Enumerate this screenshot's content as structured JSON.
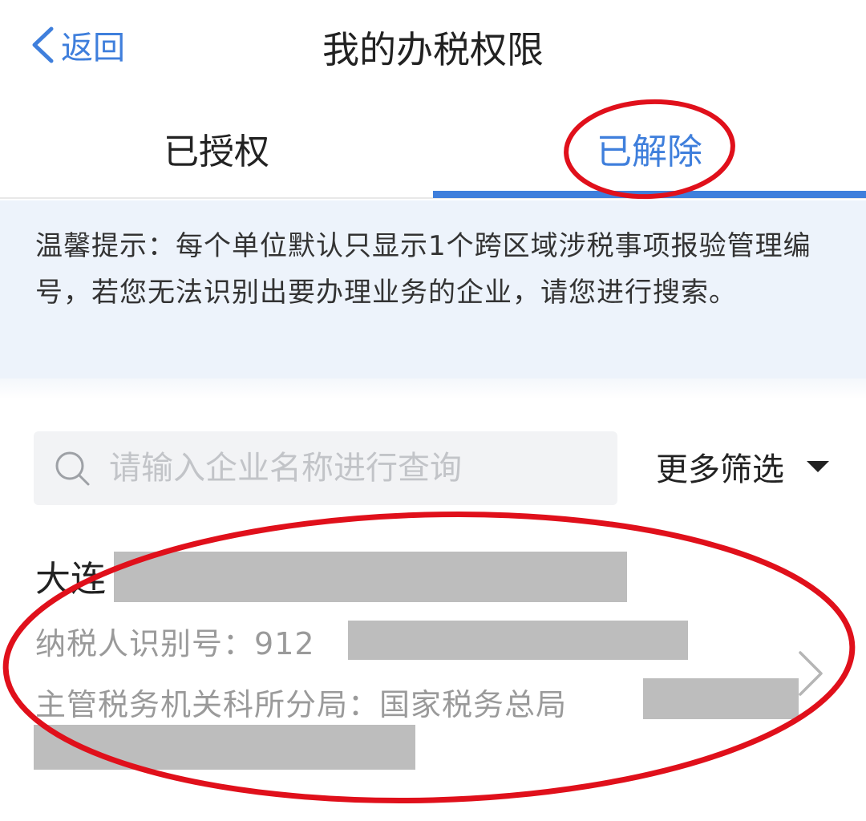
{
  "header": {
    "back_label": "返回",
    "title": "我的办税权限"
  },
  "tabs": [
    {
      "label": "已授权",
      "active": false
    },
    {
      "label": "已解除",
      "active": true
    }
  ],
  "notice": {
    "text": "温馨提示：每个单位默认只显示1个跨区域涉税事项报验管理编号，若您无法识别出要办理业务的企业，请您进行搜索。"
  },
  "search": {
    "placeholder": "请输入企业名称进行查询",
    "value": ""
  },
  "filter": {
    "label": "更多筛选"
  },
  "record": {
    "company_prefix": "大连",
    "taxid_label": "纳税人识别号：",
    "taxid_value": "912",
    "office_label": "主管税务机关科所分局：",
    "office_value": "国家税务总局"
  },
  "colors": {
    "accent": "#3f7fdc",
    "annotation": "#e0101b",
    "redaction": "#bdbdbd",
    "notice_bg": "#edf3fb"
  }
}
